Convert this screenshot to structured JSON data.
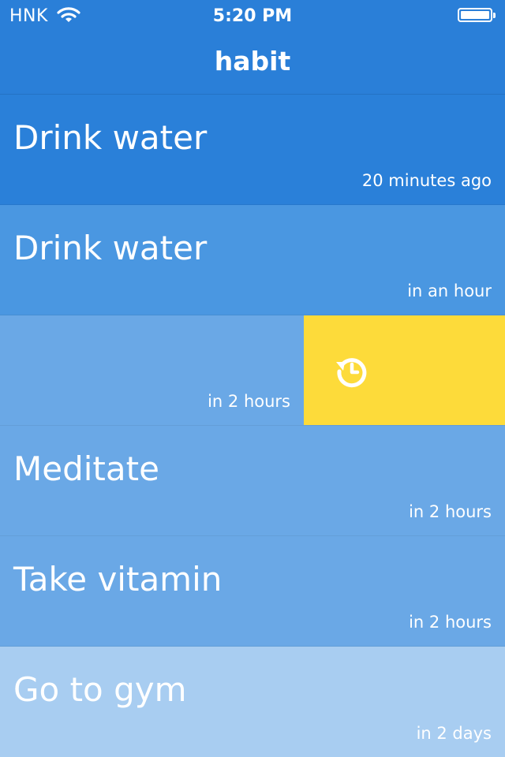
{
  "status_bar": {
    "carrier": "HNK",
    "time": "5:20 PM"
  },
  "header": {
    "title": "habit"
  },
  "habits": [
    {
      "title": "Drink water",
      "time": "20 minutes ago"
    },
    {
      "title": "Drink water",
      "time": "in an hour"
    },
    {
      "title": "",
      "time": "in 2 hours",
      "action": "snooze-icon"
    },
    {
      "title": "Meditate",
      "time": "in 2 hours"
    },
    {
      "title": "Take vitamin",
      "time": "in 2 hours"
    },
    {
      "title": "Go to gym",
      "time": "in 2 days"
    }
  ],
  "colors": {
    "accent": "#2a80d9",
    "snooze_action": "#fddb3a"
  }
}
